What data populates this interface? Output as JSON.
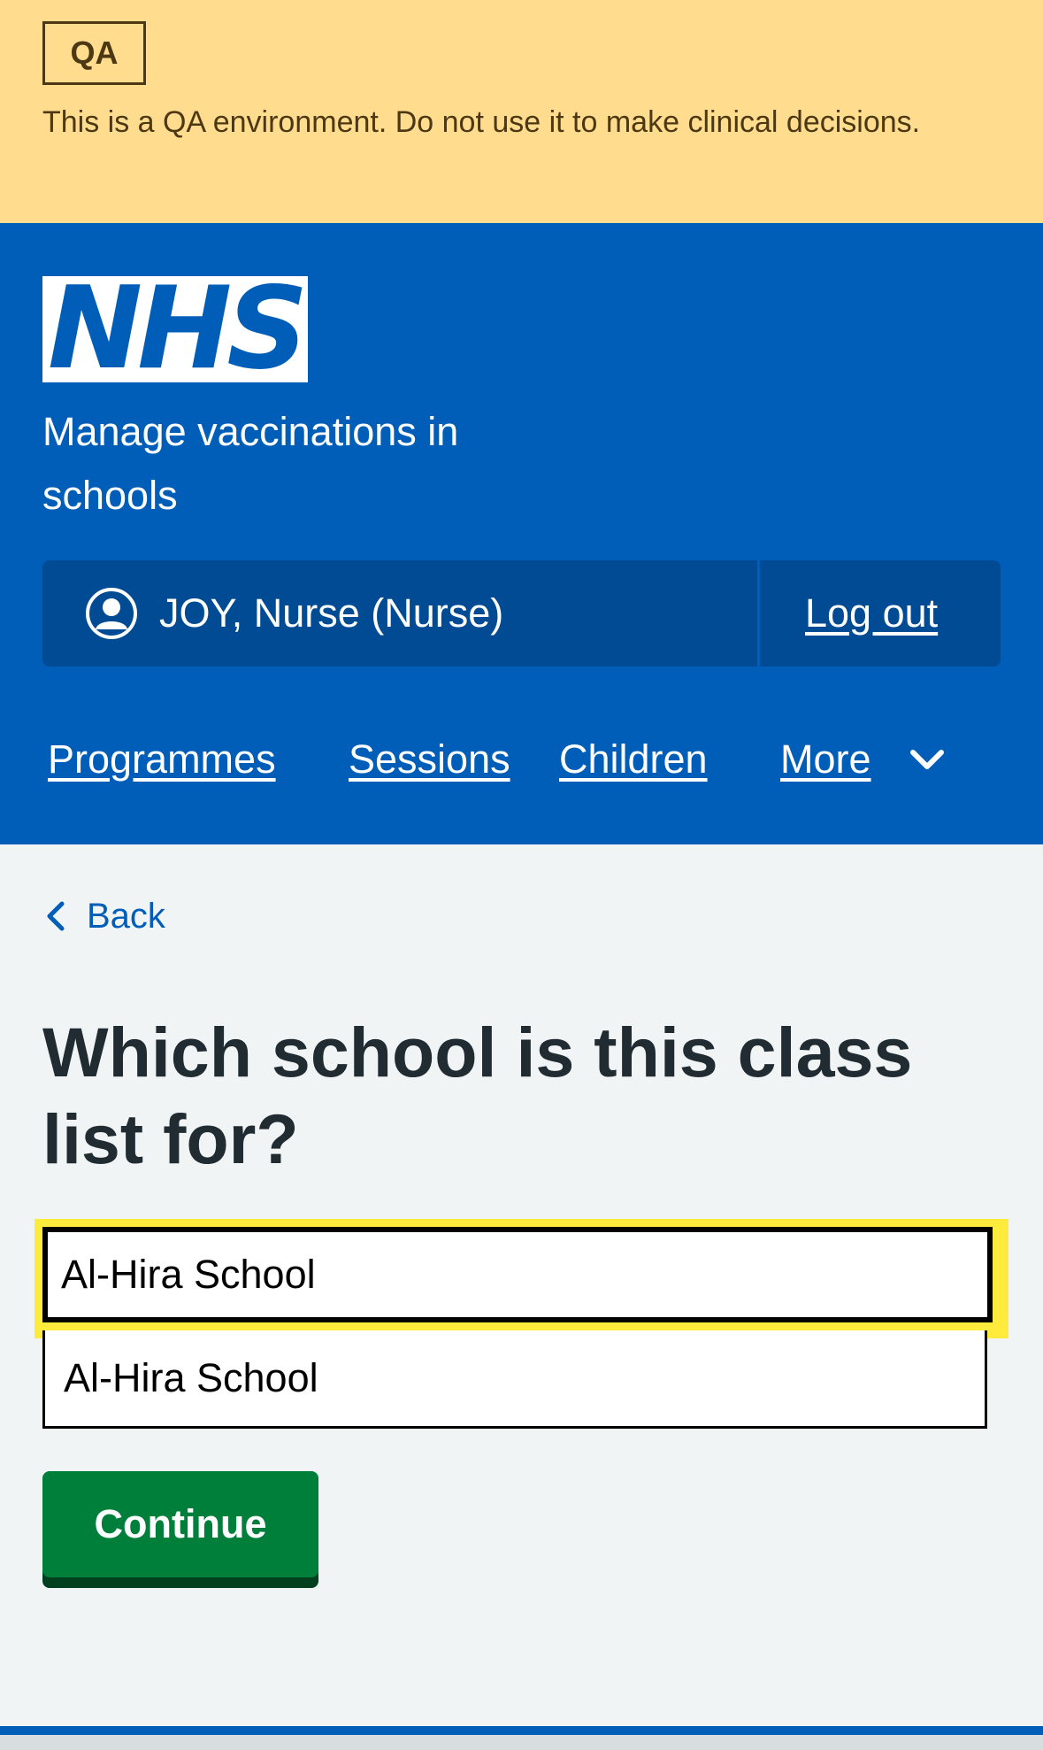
{
  "qa_banner": {
    "tag": "QA",
    "message": "This is a QA environment. Do not use it to make clinical decisions."
  },
  "header": {
    "logo_text": "NHS",
    "service_name": "Manage vaccinations in schools",
    "account": {
      "user_name": "JOY, Nurse (Nurse)",
      "logout_label": "Log out"
    },
    "nav": {
      "programmes": "Programmes",
      "sessions": "Sessions",
      "children": "Children",
      "more": "More"
    }
  },
  "main": {
    "back_label": "Back",
    "title": "Which school is this class list for?",
    "school_input_value": "Al-Hira School",
    "suggestion_option": "Al-Hira School",
    "continue_label": "Continue"
  },
  "colors": {
    "nhs_blue": "#005eb8",
    "qa_yellow": "#ffdc8e",
    "focus_yellow": "#ffeb3b",
    "button_green": "#007f3b"
  }
}
